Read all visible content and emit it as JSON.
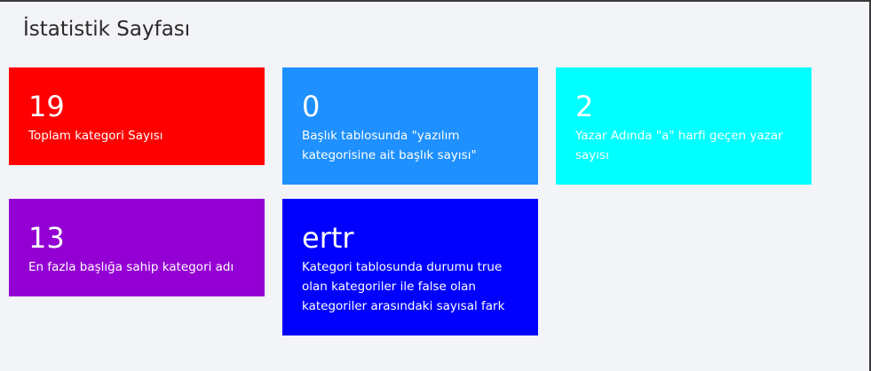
{
  "page": {
    "title": "İstatistik Sayfası"
  },
  "cards": [
    {
      "value": "19",
      "label": "Toplam kategori Sayısı",
      "color": "#ff0000"
    },
    {
      "value": "0",
      "label": "Başlık tablosunda \"yazılım kategorisine ait başlık sayısı\"",
      "color": "#1e90ff"
    },
    {
      "value": "2",
      "label": "Yazar Adında \"a\" harfi geçen yazar sayısı",
      "color": "#00ffff"
    },
    {
      "value": "13",
      "label": "En fazla başlığa sahip kategori adı",
      "color": "#9400d3"
    },
    {
      "value": "ertr",
      "label": "Kategori tablosunda durumu true olan kategoriler ile false olan kategoriler arasındaki sayısal fark",
      "color": "#0000ff"
    }
  ]
}
